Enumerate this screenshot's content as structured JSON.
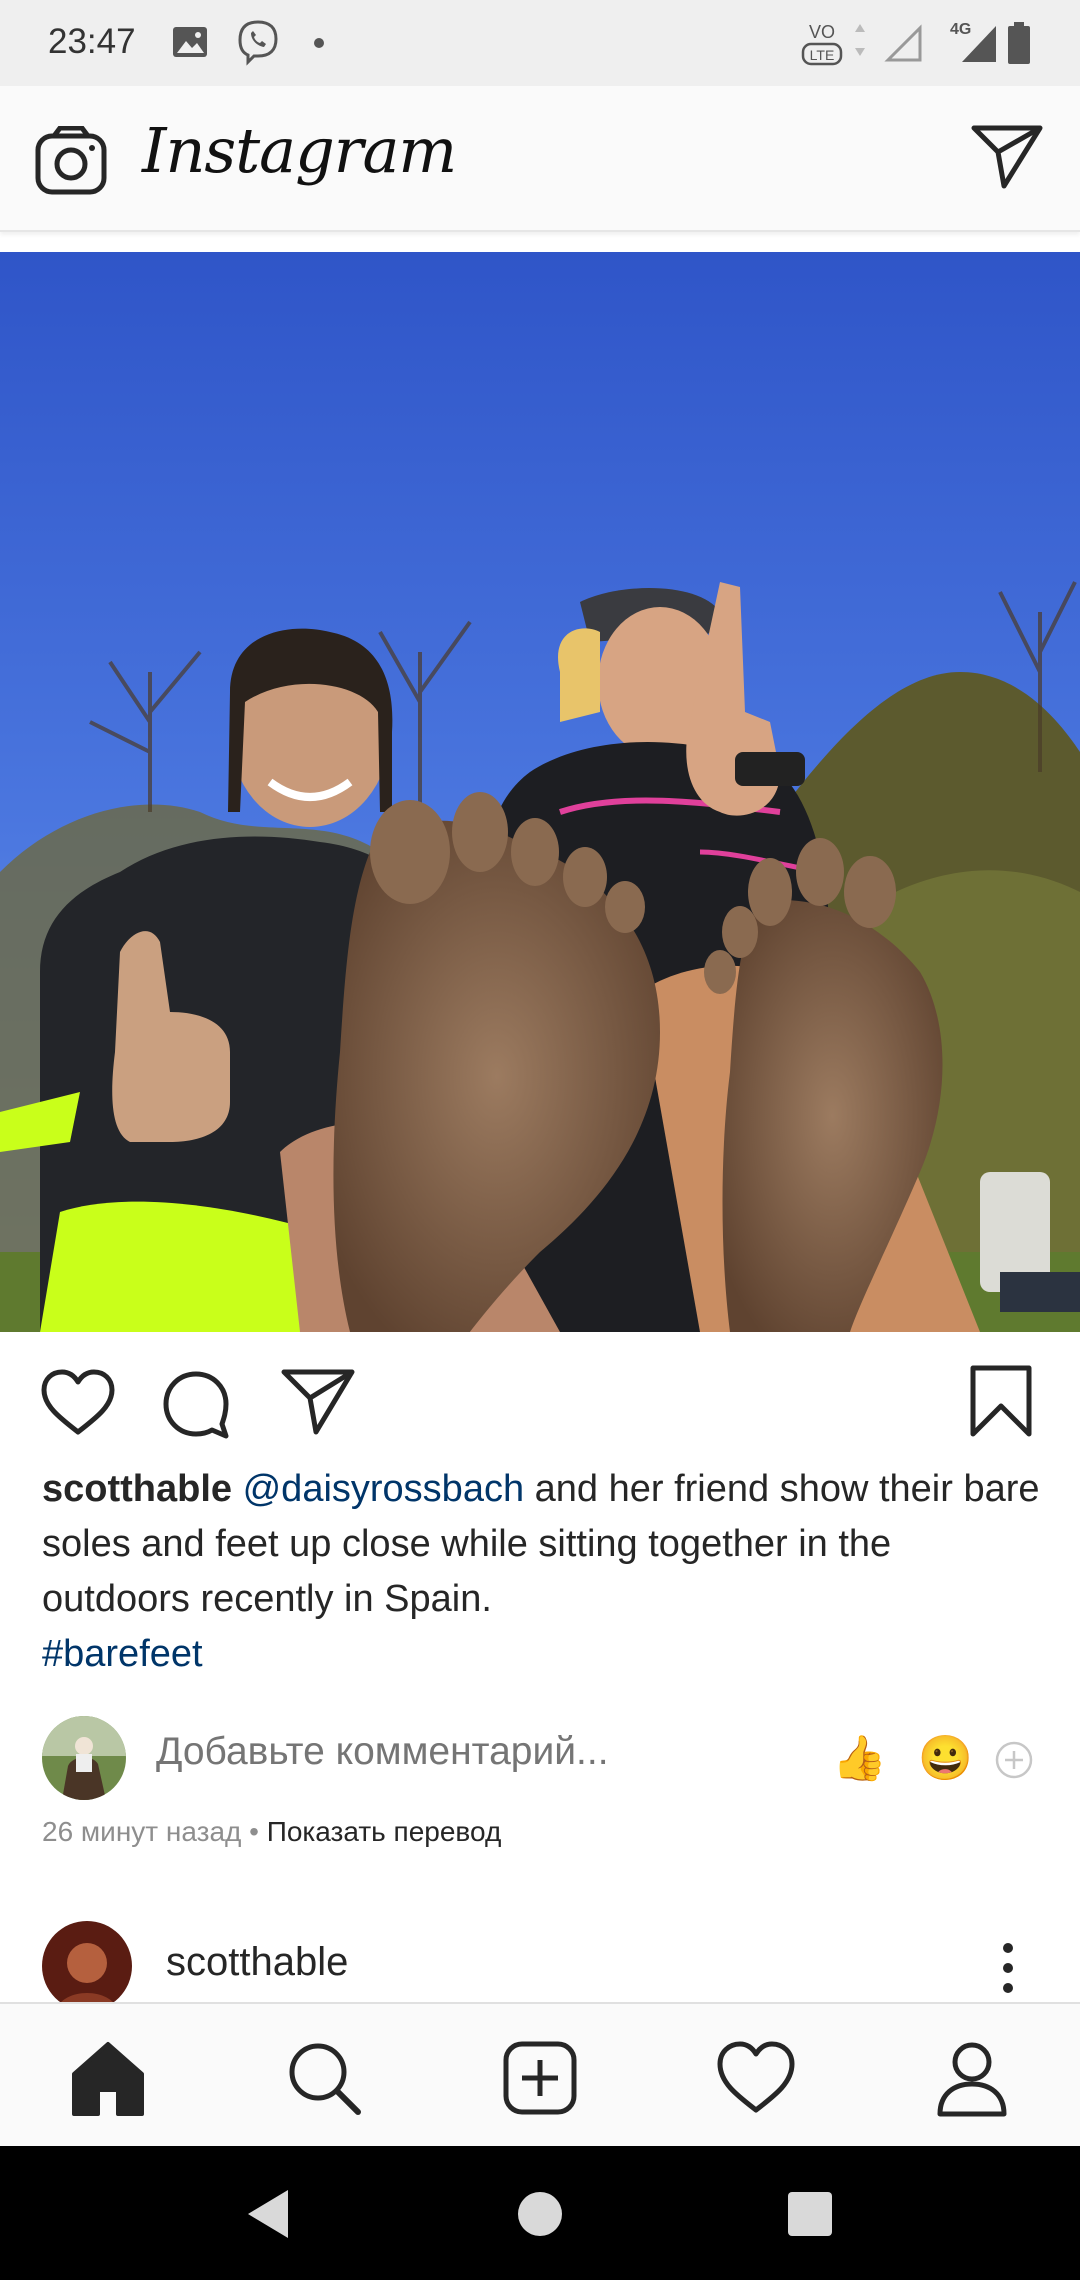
{
  "status_bar": {
    "time": "23:47",
    "network": "4G",
    "volte": "VoLTE"
  },
  "app": {
    "title": "Instagram",
    "icons": [
      "camera-icon",
      "direct-message-icon"
    ]
  },
  "post": {
    "username": "scotthable",
    "mention": "@daisyrossbach",
    "caption_text": " and her friend show their bare soles and feet up close while sitting together in the outdoors recently in Spain.",
    "hashtag": "#barefeet",
    "comment_placeholder": "Добавьте комментарий...",
    "quick_emojis": [
      "👍",
      "😀"
    ],
    "time_ago": "26 минут назад",
    "separator": " • ",
    "show_translation": "Показать перевод"
  },
  "next_post": {
    "username": "scotthable"
  },
  "tab_bar": {
    "tabs": [
      "home",
      "search",
      "new-post",
      "activity",
      "profile"
    ],
    "active": "home"
  },
  "colors": {
    "link": "#003569",
    "muted": "#8e8e8e",
    "text": "#262626",
    "bar": "#fafafa"
  }
}
